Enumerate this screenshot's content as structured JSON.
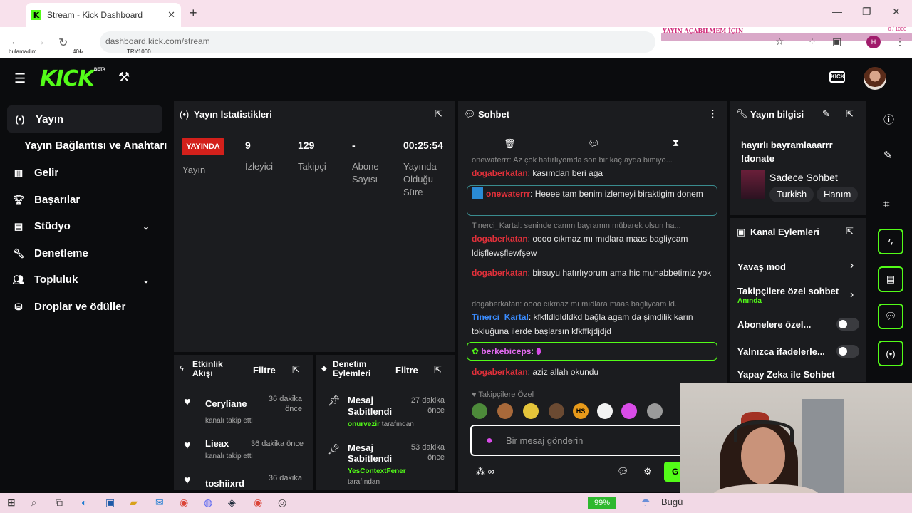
{
  "browser": {
    "tab_title": "Stream - Kick Dashboard",
    "tab_close": "✕",
    "new_tab": "+",
    "url": "dashboard.kick.com/stream",
    "overlay_goal": "YAYIN AÇABILMEM İÇIN",
    "overlay_count": "0 / 1000",
    "overlay_left_1": "bulamadım",
    "overlay_left_2": "40₺",
    "overlay_left_3": "TRY1000"
  },
  "header": {
    "logo": "KICK",
    "beta": "BETA",
    "icon_label": "KICK"
  },
  "sidebar": {
    "items": [
      {
        "label": "Yayın",
        "icon": "broadcast-icon"
      },
      {
        "label": "Yayın Bağlantısı ve Anahtarı"
      },
      {
        "label": "Gelir",
        "icon": "chart-icon"
      },
      {
        "label": "Başarılar",
        "icon": "trophy-icon"
      },
      {
        "label": "Stüdyo",
        "icon": "studio-icon"
      },
      {
        "label": "Denetleme",
        "icon": "wrench-icon"
      },
      {
        "label": "Topluluk",
        "icon": "community-icon"
      },
      {
        "label": "Droplar ve ödüller",
        "icon": "drops-icon"
      }
    ]
  },
  "stats": {
    "title": "Yayın İstatistikleri",
    "live": "YAYINDA",
    "live_label": "Yayın",
    "viewers": "9",
    "viewers_label": "İzleyici",
    "followers": "129",
    "followers_label": "Takipçi",
    "subs": "-",
    "subs_label_1": "Abone",
    "subs_label_2": "Sayısı",
    "duration": "00:25:54",
    "duration_label_1": "Yayında",
    "duration_label_2": "Olduğu",
    "duration_label_3": "Süre"
  },
  "activity": {
    "title_1": "Etkinlik",
    "title_2": "Akışı",
    "filter": "Filtre",
    "rows": [
      {
        "name": "Ceryliane",
        "sub": "kanalı takip etti",
        "time_1": "36 dakika",
        "time_2": "önce"
      },
      {
        "name": "Lieax",
        "sub": "kanalı takip etti",
        "time_1": "36 dakika önce",
        "time_2": ""
      },
      {
        "name": "toshiixrd",
        "sub": "",
        "time_1": "36 dakika",
        "time_2": ""
      }
    ]
  },
  "moderation": {
    "title_1": "Denetim",
    "title_2": "Eylemleri",
    "filter": "Filtre",
    "rows": [
      {
        "name_1": "Mesaj",
        "name_2": "Sabitlendi",
        "user": "onurvezir",
        "by": "tarafından",
        "time_1": "27 dakika",
        "time_2": "önce"
      },
      {
        "name_1": "Mesaj",
        "name_2": "Sabitlendi",
        "user": "YesContextFener",
        "by": "tarafından",
        "time_1": "53 dakika",
        "time_2": "önce"
      }
    ]
  },
  "chat": {
    "title": "Sohbet",
    "messages": [
      {
        "reply": "onewaterrr: Az çok hatırlıyomda son bir kaç ayda bimiyo..."
      },
      {
        "user": "dogaberkatan",
        "text": ": kasımdan beri aga"
      },
      {
        "user": "onewaterrr",
        "text": ": Heeee tam benim izlemeyi biraktigim donem"
      },
      {
        "reply": "Tinerci_Kartal: seninde canım bayramın mübarek olsun ha..."
      },
      {
        "user": "dogaberkatan",
        "text": ": oooo cıkmaz mı mıdlara maas bagliycam ldişflewşflewfşew"
      },
      {
        "user": "dogaberkatan",
        "text": ": birsuyu hatırlıyorum ama hic muhabbetimiz yok"
      },
      {
        "reply": "dogaberkatan: oooo cıkmaz mı mıdlara maas bagliycam ld..."
      },
      {
        "user": "Tinerci_Kartal",
        "text": ": kfkfldldldldkd bağla agam da şimdilik karın tokluğuna ilerde başlarsın kfkffkjdjdjd"
      },
      {
        "user": "berkebiceps",
        "text": ":"
      },
      {
        "user": "dogaberkatan",
        "text": ": aziz allah okundu"
      }
    ],
    "followers_only": "Takipçilere Özel",
    "placeholder": "Bir mesaj gönderin",
    "send": "G"
  },
  "info": {
    "title": "Yayın bilgisi",
    "stream_title_1": "hayırlı bayramlaaarrr",
    "stream_title_2": "!donate",
    "category": "Sadece Sohbet",
    "tags": [
      "Turkish",
      "Hanım"
    ]
  },
  "channel_actions": {
    "title": "Kanal Eylemleri",
    "items": [
      {
        "label": "Yavaş mod"
      },
      {
        "label": "Takipçilere özel sohbet",
        "sub": "Anında"
      },
      {
        "label": "Abonelere özel..."
      },
      {
        "label": "Yalnızca ifadelerle..."
      },
      {
        "label": "Yapay Zeka ile Sohbet"
      }
    ]
  },
  "taskbar": {
    "battery": "99%",
    "weather": "Bugü"
  },
  "colors": {
    "kick_green": "#53fc18",
    "live_red": "#d3201b",
    "user_red": "#e0303a",
    "user_blue": "#3a8cff",
    "user_green": "#53fc18"
  }
}
